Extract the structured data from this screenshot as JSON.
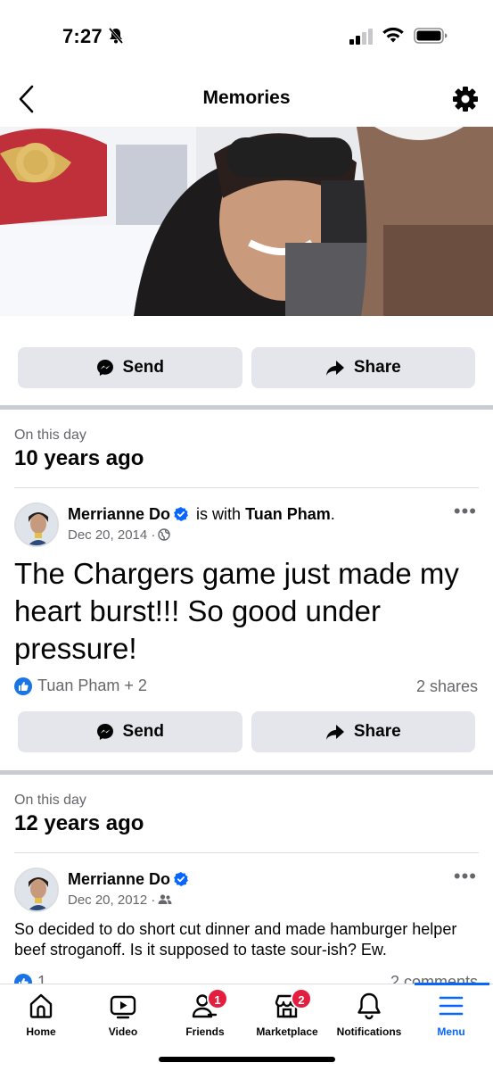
{
  "status_bar": {
    "time": "7:27"
  },
  "header": {
    "title": "Memories"
  },
  "memory_1": {
    "send_label": "Send",
    "share_label": "Share"
  },
  "memory_2": {
    "on_this_day": "On this day",
    "years_ago": "10 years ago",
    "author": "Merrianne Do",
    "with_text": "is with",
    "with_name": "Tuan Pham",
    "with_period": ".",
    "date": "Dec 20, 2014 ·",
    "privacy_icon": "globe-icon",
    "post_text": "The Chargers game just made my heart burst!!! So good under pressure!",
    "reactions": "Tuan Pham + 2",
    "shares": "2 shares",
    "send_label": "Send",
    "share_label": "Share"
  },
  "memory_3": {
    "on_this_day": "On this day",
    "years_ago": "12 years ago",
    "author": "Merrianne Do",
    "date": "Dec 20, 2012 ·",
    "privacy_icon": "friends-icon",
    "post_text": "So decided to do short cut dinner and made hamburger helper beef stroganoff. Is it supposed to taste sour-ish? Ew.",
    "reactions": "1",
    "comments": "2 comments"
  },
  "bottom_nav": {
    "items": [
      {
        "label": "Home",
        "icon": "home-icon"
      },
      {
        "label": "Video",
        "icon": "video-icon"
      },
      {
        "label": "Friends",
        "icon": "friends-icon",
        "badge": "1"
      },
      {
        "label": "Marketplace",
        "icon": "marketplace-icon",
        "badge": "2"
      },
      {
        "label": "Notifications",
        "icon": "bell-icon"
      },
      {
        "label": "Menu",
        "icon": "menu-icon",
        "active": true
      }
    ]
  },
  "colors": {
    "accent": "#0866ff",
    "badge": "#e41e3f",
    "button_bg": "#e4e6eb",
    "secondary_text": "#65676b"
  }
}
